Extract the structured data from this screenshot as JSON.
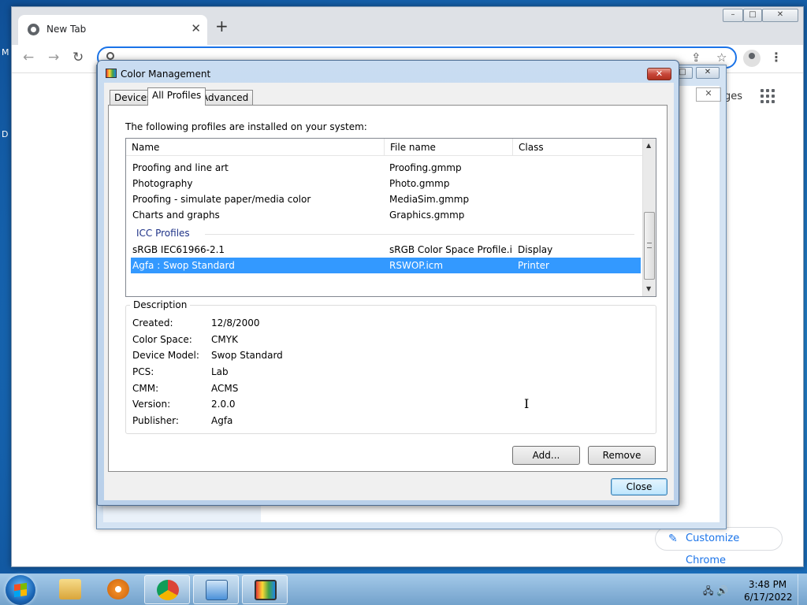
{
  "browser": {
    "tab_title": "New Tab",
    "new_tab_symbol": "+",
    "tab_close_symbol": "✕",
    "images_link_partial": "ges",
    "customize_button": "Customize Chrome"
  },
  "desktop": {
    "edge_glyph_1": "M",
    "edge_glyph_2": "D"
  },
  "dialog": {
    "title": "Color Management",
    "close_symbol": "✕",
    "tabs": [
      {
        "label": "Devices",
        "active": false
      },
      {
        "label": "All Profiles",
        "active": true
      },
      {
        "label": "Advanced",
        "active": false
      }
    ],
    "intro": "The following profiles are installed on your system:",
    "columns": [
      "Name",
      "File name",
      "Class"
    ],
    "rows": [
      {
        "name": "Proofing and line art",
        "file": "Proofing.gmmp",
        "class": ""
      },
      {
        "name": "Photography",
        "file": "Photo.gmmp",
        "class": ""
      },
      {
        "name": "Proofing - simulate paper/media color",
        "file": "MediaSim.gmmp",
        "class": ""
      },
      {
        "name": "Charts and graphs",
        "file": "Graphics.gmmp",
        "class": ""
      }
    ],
    "group_label": "ICC Profiles",
    "icc_rows": [
      {
        "name": "sRGB IEC61966-2.1",
        "file": "sRGB Color Space Profile.ic...",
        "class": "Display",
        "selected": false
      },
      {
        "name": "Agfa : Swop Standard",
        "file": "RSWOP.icm",
        "class": "Printer",
        "selected": true
      }
    ],
    "description": {
      "legend": "Description",
      "fields": [
        {
          "key": "Created:",
          "value": "12/8/2000"
        },
        {
          "key": "Color Space:",
          "value": "CMYK"
        },
        {
          "key": "Device Model:",
          "value": "Swop Standard"
        },
        {
          "key": "PCS:",
          "value": "Lab"
        },
        {
          "key": "CMM:",
          "value": "ACMS"
        },
        {
          "key": "Version:",
          "value": "2.0.0"
        },
        {
          "key": "Publisher:",
          "value": "Agfa"
        }
      ]
    },
    "add_button": "Add...",
    "remove_button": "Remove",
    "close_button": "Close"
  },
  "taskbar": {
    "time": "3:48 PM",
    "date": "6/17/2022",
    "items": [
      {
        "name": "file-explorer",
        "color": "#e8c15a"
      },
      {
        "name": "media-player",
        "color": "#f08a24"
      },
      {
        "name": "chrome",
        "color": "#db4437"
      },
      {
        "name": "control-panel",
        "color": "#4a90d9"
      },
      {
        "name": "color-management",
        "color": "#2a5fa8"
      }
    ]
  },
  "colors": {
    "selection": "#3399ff",
    "accent": "#1a73e8"
  }
}
